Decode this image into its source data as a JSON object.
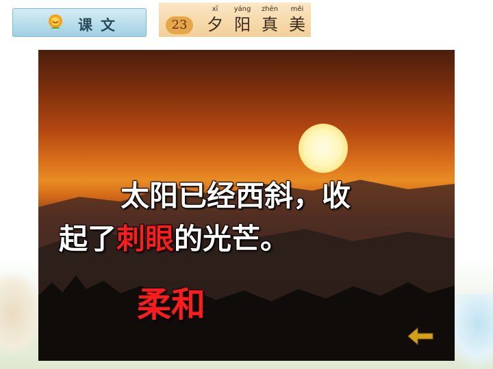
{
  "header": {
    "lesson_tab_label": "课文",
    "lesson_number": "23",
    "title_chars": [
      {
        "pinyin": "xī",
        "hanzi": "夕"
      },
      {
        "pinyin": "yáng",
        "hanzi": "阳"
      },
      {
        "pinyin": "zhēn",
        "hanzi": "真"
      },
      {
        "pinyin": "měi",
        "hanzi": "美"
      }
    ]
  },
  "slide": {
    "line1": "太阳已经西斜，收",
    "line2_before": "起了",
    "line2_highlight": "刺眼",
    "line2_after": "的光芒。",
    "answer": "柔和"
  },
  "icons": {
    "back": "back-arrow-icon",
    "logo": "flower-icon"
  },
  "colors": {
    "highlight": "#ff1c1c",
    "back_arrow": "#d4a017"
  }
}
